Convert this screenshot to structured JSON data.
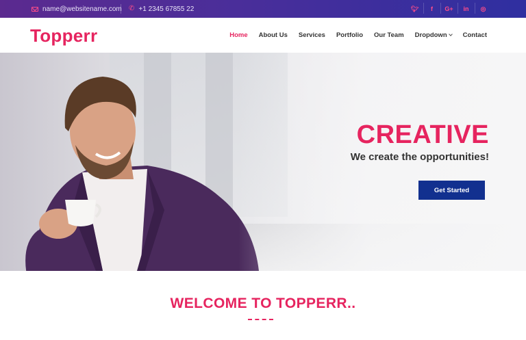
{
  "topbar": {
    "email": "name@websitename.com",
    "phone": "+1 2345 67855 22",
    "social": [
      {
        "icon": "twitter-icon",
        "glyph": "🐦︎"
      },
      {
        "icon": "facebook-icon",
        "glyph": "f"
      },
      {
        "icon": "google-plus-icon",
        "glyph": "G+"
      },
      {
        "icon": "linkedin-icon",
        "glyph": "in"
      },
      {
        "icon": "instagram-icon",
        "glyph": "◎"
      }
    ]
  },
  "brand": {
    "name": "Topperr",
    "accent": "#e6245f",
    "button": "#12308f"
  },
  "nav": {
    "items": [
      "Home",
      "About Us",
      "Services",
      "Portfolio",
      "Our Team",
      "Dropdown",
      "Contact"
    ],
    "active": "Home"
  },
  "hero": {
    "title": "CREATIVE",
    "subtitle": "We create the opportunities!",
    "cta": "Get Started"
  },
  "welcome": {
    "heading": "WELCOME TO TOPPERR.."
  }
}
